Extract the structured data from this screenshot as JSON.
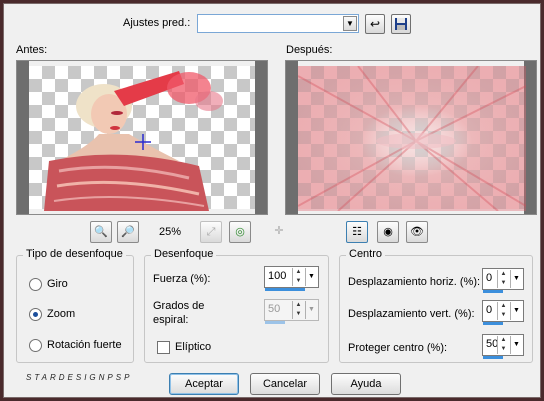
{
  "preset": {
    "label": "Ajustes pred.:",
    "value": "",
    "reset_icon": "reset-arrow-icon",
    "save_icon": "floppy-disk-icon"
  },
  "preview": {
    "before_label": "Antes:",
    "after_label": "Después:"
  },
  "toolbar": {
    "zoom_level": "25%",
    "zoom_out_icon": "zoom-out-icon",
    "zoom_in_icon": "zoom-in-icon",
    "fit_icon": "fit-window-icon",
    "actual_size_icon": "zoom-100-icon",
    "pan_icon": "pan-cross-icon",
    "layout_icon": "preview-layout-icon",
    "eye_toggle_icon": "eye-refresh-icon",
    "eye_icon": "eye-icon"
  },
  "blur_type": {
    "title": "Tipo de desenfoque",
    "options": [
      "Giro",
      "Zoom",
      "Rotación fuerte"
    ],
    "selected": "Zoom"
  },
  "blur": {
    "title": "Desenfoque",
    "strength_label": "Fuerza (%):",
    "strength_value": "100",
    "spiral_label_1": "Grados de",
    "spiral_label_2": "espiral:",
    "spiral_value": "50",
    "elliptic_label": "Elíptico",
    "elliptic_checked": false
  },
  "center": {
    "title": "Centro",
    "h_offset_label": "Desplazamiento horiz. (%):",
    "h_offset_value": "0",
    "v_offset_label": "Desplazamiento vert. (%):",
    "v_offset_value": "0",
    "protect_label": "Proteger centro (%):",
    "protect_value": "50"
  },
  "buttons": {
    "accept": "Aceptar",
    "cancel": "Cancelar",
    "help": "Ayuda"
  },
  "watermark": "STARDESIGNPSP",
  "colors": {
    "accent": "#3c8fdc",
    "frame": "#4a2a2c",
    "dialog_bg": "#f0f0f0"
  }
}
